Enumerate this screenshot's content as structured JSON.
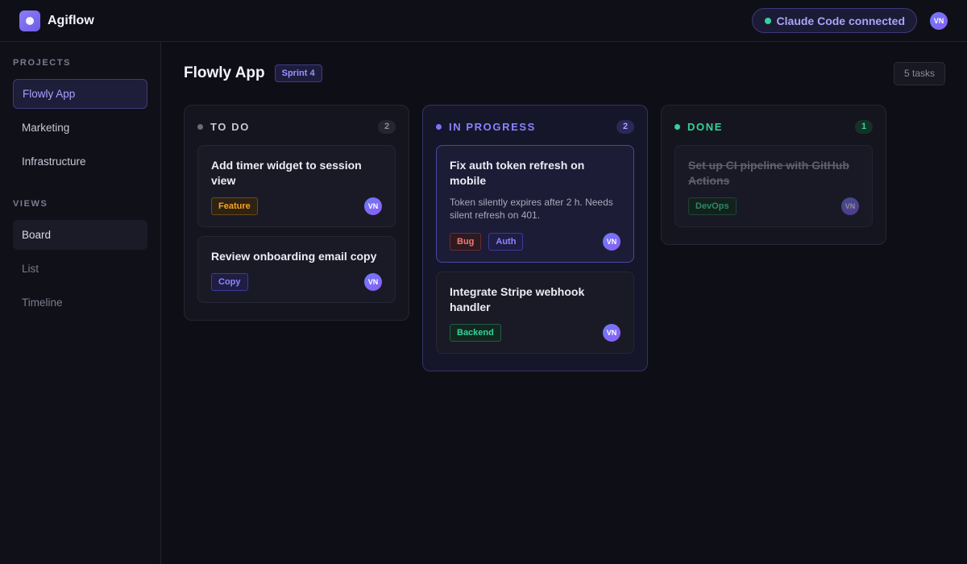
{
  "app": {
    "name": "Agiflow"
  },
  "header": {
    "connection_label": "Claude Code connected",
    "user_initials": "VN"
  },
  "sidebar": {
    "projects_heading": "PROJECTS",
    "projects": [
      {
        "label": "Flowly App",
        "active": true
      },
      {
        "label": "Marketing",
        "active": false
      },
      {
        "label": "Infrastructure",
        "active": false
      }
    ],
    "views_heading": "VIEWS",
    "views": [
      {
        "label": "Board",
        "active": true
      },
      {
        "label": "List",
        "active": false
      },
      {
        "label": "Timeline",
        "active": false
      }
    ]
  },
  "board": {
    "title": "Flowly App",
    "sprint": "Sprint 4",
    "task_count": "5 tasks"
  },
  "columns": [
    {
      "title": "TO DO",
      "count": "2",
      "color": "#6b6b7b",
      "cards": [
        {
          "title": "Add timer widget to session view",
          "tags": [
            "Feature"
          ],
          "assignee": "VN"
        },
        {
          "title": "Review onboarding email copy",
          "tags": [
            "Copy"
          ],
          "assignee": "VN"
        }
      ]
    },
    {
      "title": "IN PROGRESS",
      "count": "2",
      "color": "#7c74f7",
      "cards": [
        {
          "title": "Fix auth token refresh on mobile",
          "description": "Token silently expires after 2 h. Needs silent refresh on 401.",
          "tags": [
            "Bug",
            "Auth"
          ],
          "assignee": "VN"
        },
        {
          "title": "Integrate Stripe webhook handler",
          "tags": [
            "Backend"
          ],
          "assignee": "VN"
        }
      ]
    },
    {
      "title": "DONE",
      "count": "1",
      "color": "#34d399",
      "cards": [
        {
          "title": "Set up CI pipeline with GitHub Actions",
          "tags": [
            "DevOps"
          ],
          "assignee": "VN"
        }
      ]
    }
  ]
}
